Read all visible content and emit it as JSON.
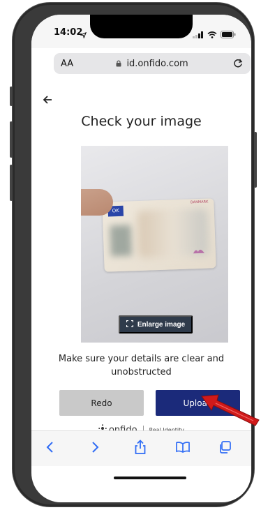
{
  "status_bar": {
    "time": "14:02"
  },
  "browser": {
    "aa_label": "AA",
    "url": "id.onfido.com"
  },
  "page": {
    "title": "Check your image",
    "enlarge_label": "Enlarge image",
    "photo_card": {
      "flag_text": "OK",
      "country_text": "DANMARK"
    },
    "instructions": "Make sure your details are clear and unobstructed",
    "redo_label": "Redo",
    "upload_label": "Upload",
    "brand": "onfido",
    "tagline": "Real Identity"
  },
  "toolbar": {
    "icons": [
      "back-icon",
      "forward-icon",
      "share-icon",
      "bookmarks-icon",
      "tabs-icon"
    ]
  },
  "colors": {
    "primary": "#1b2a7a",
    "secondary_button": "#c9c9c9",
    "enlarge_bg": "#2f3b4b",
    "toolbar_icon": "#2f6cf5",
    "annotation_arrow": "#d11a1a"
  }
}
